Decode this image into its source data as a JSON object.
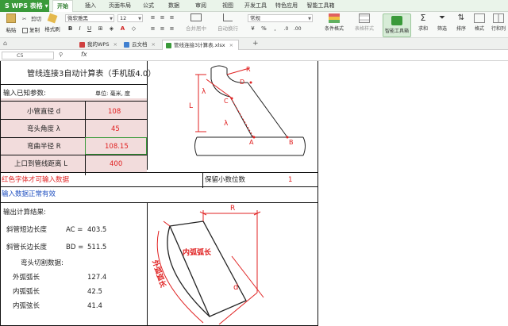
{
  "app": {
    "name": "WPS 表格"
  },
  "menu": [
    "开始",
    "插入",
    "页面布局",
    "公式",
    "数据",
    "审阅",
    "视图",
    "开发工具",
    "特色应用",
    "智能工具箱"
  ],
  "toolbar": {
    "paste": "粘贴",
    "cut": "剪切",
    "copy": "复制",
    "format_painter": "格式刷",
    "font_name": "微软雅黑",
    "font_size": "12",
    "merge_center": "合并居中",
    "wrap_text": "自动换行",
    "number_format": "常规",
    "conditional_format": "条件格式",
    "table_style": "表格样式",
    "smart_toolbox": "智能工具箱",
    "sum": "求和",
    "filter": "筛选",
    "sort": "排序",
    "format": "格式",
    "row_col": "行和列"
  },
  "tabs": [
    {
      "label": "我的WPS",
      "color": "#d04040"
    },
    {
      "label": "云文档",
      "color": "#4080d0"
    },
    {
      "label": "管线连接3计算表.xlsx",
      "color": "#3a9a3a"
    }
  ],
  "formula_bar": {
    "cell_ref": "C5",
    "fx": "fx",
    "value": ""
  },
  "sheet": {
    "title": "管线连接3自动计算表（手机版4.0）",
    "input_label": "输入已知参数:",
    "unit_label": "单位: 毫米, 度",
    "params": [
      {
        "label": "小管直径 d",
        "value": "108"
      },
      {
        "label": "弯头角度 λ",
        "value": "45"
      },
      {
        "label": "弯曲半径 R",
        "value": "108.15"
      },
      {
        "label": "上口到管线距离 L",
        "value": "400"
      }
    ],
    "red_note": "红色字体才可输入数据",
    "decimals_label": "保留小数位数",
    "decimals_value": "1",
    "status_note": "输入数据正常有效",
    "output_label": "输出计算结果:",
    "results": [
      {
        "label": "斜管短边长度",
        "key": "AC =",
        "value": "403.5"
      },
      {
        "label": "斜管长边长度",
        "key": "BD =",
        "value": "511.5"
      }
    ],
    "cut_label": "弯头切割数据:",
    "cut_rows": [
      {
        "label": "外弧弧长",
        "value": "127.4"
      },
      {
        "label": "内弧弧长",
        "value": "42.5"
      },
      {
        "label": "内弧弦长",
        "value": "41.4"
      }
    ]
  },
  "diagram1": {
    "labels": [
      "L",
      "R",
      "D",
      "C",
      "λ",
      "λ",
      "A",
      "B"
    ]
  },
  "diagram2": {
    "labels": [
      "R",
      "内弧弧长",
      "外弧弧长",
      "d"
    ]
  },
  "colors": {
    "accent": "#3a9a3a",
    "input_bg": "#f2dcdc",
    "red": "#e02020",
    "blue": "#2050c0"
  }
}
